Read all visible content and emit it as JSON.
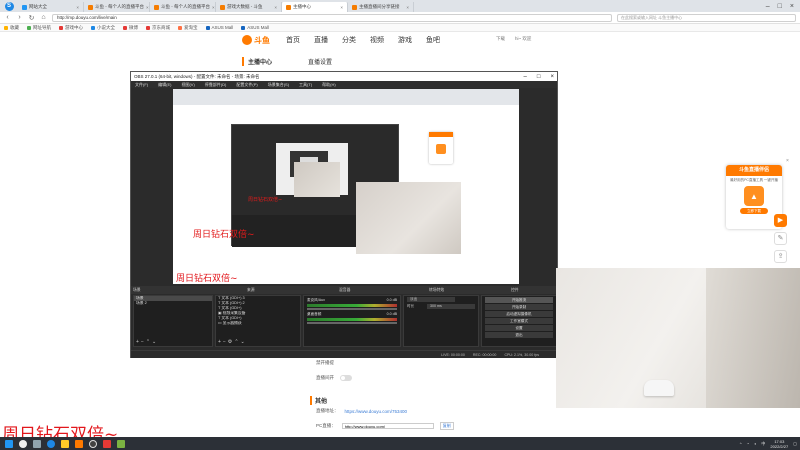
{
  "browser": {
    "tabs": [
      {
        "label": "网站大全",
        "active": false
      },
      {
        "label": "斗鱼 - 每个人的直播平台",
        "active": false
      },
      {
        "label": "斗鱼 - 每个人的直播平台",
        "active": false
      },
      {
        "label": "游戏大数据 - 斗鱼",
        "active": false
      },
      {
        "label": "主播中心",
        "active": true
      },
      {
        "label": "主播直播间分享链接",
        "active": false
      }
    ],
    "address": "http://mp.douyu.com/live/main",
    "search_placeholder": "在此搜索或输入网址 斗鱼主播中心",
    "bookmarks": [
      "收藏",
      "网址导航",
      "游戏中心",
      "小说大全",
      "微博",
      "京东商城",
      "爱淘宝",
      "ASUS Mall",
      "ASUS Mall"
    ]
  },
  "site": {
    "logo_text": "斗鱼",
    "nav": [
      "首页",
      "直播",
      "分类",
      "视频",
      "游戏",
      "鱼吧"
    ],
    "header_right": [
      "下载",
      "hi~ 欢迎"
    ],
    "sidebar_title": "主播中心",
    "content_title": "直播设置",
    "rows": {
      "save_label": "禁开播提",
      "auto_label": "直播间开",
      "other_title": "其他",
      "room_link_label": "直播地址：",
      "room_link": "https://www.douyu.com/753400",
      "pc_link_label": "PC直播：",
      "pc_link": "http://www.douyu.com/",
      "copy": "复制"
    },
    "promo": {
      "title": "斗鱼直播伴侣",
      "desc": "最好用的PC直播工具 一键开播",
      "button": "立即下载"
    }
  },
  "obs": {
    "title": "OBS 27.0.1 (64-bit, windows) - 配置文件: 未命名 - 场景: 未命名",
    "menu": [
      "文件(F)",
      "编辑(E)",
      "视图(V)",
      "停靠部件(D)",
      "配置文件(P)",
      "场景集合(S)",
      "工具(T)",
      "帮助(H)"
    ],
    "dock_headers": [
      "场景",
      "来源",
      "混音器",
      "转场特效",
      "控件"
    ],
    "scenes": [
      "场景",
      "场景 2"
    ],
    "sources": [
      "文本 (GDI+) 3",
      "文本 (GDI+) 2",
      "文本 (GDI+)",
      "视频采集设备",
      "文本 (GDI+)",
      "显示器捕获"
    ],
    "mixer": [
      {
        "name": "麦克风/Aux",
        "db": "0.0 dB"
      },
      {
        "name": "桌面音频",
        "db": "0.0 dB"
      }
    ],
    "transition": {
      "name": "淡出",
      "duration_label": "时长",
      "duration": "300 ms"
    },
    "controls": [
      "开始推流",
      "开始录制",
      "启动虚拟摄像机",
      "工作室模式",
      "设置",
      "退出"
    ],
    "status": [
      "LIVE: 00:00:00",
      "REC: 00:00:00",
      "CPU: 2.1%, 30.00 fps"
    ]
  },
  "overlay": {
    "red_text": "周日钻石双倍~",
    "red_text_small": "周日钻石双倍~"
  },
  "taskbar": {
    "time": "17:03",
    "date": "2022/2/27",
    "ime": "中"
  },
  "colors": {
    "brand_orange": "#ff7a00",
    "overlay_red": "#e2171c",
    "obs_bg": "#2b2b2b"
  }
}
